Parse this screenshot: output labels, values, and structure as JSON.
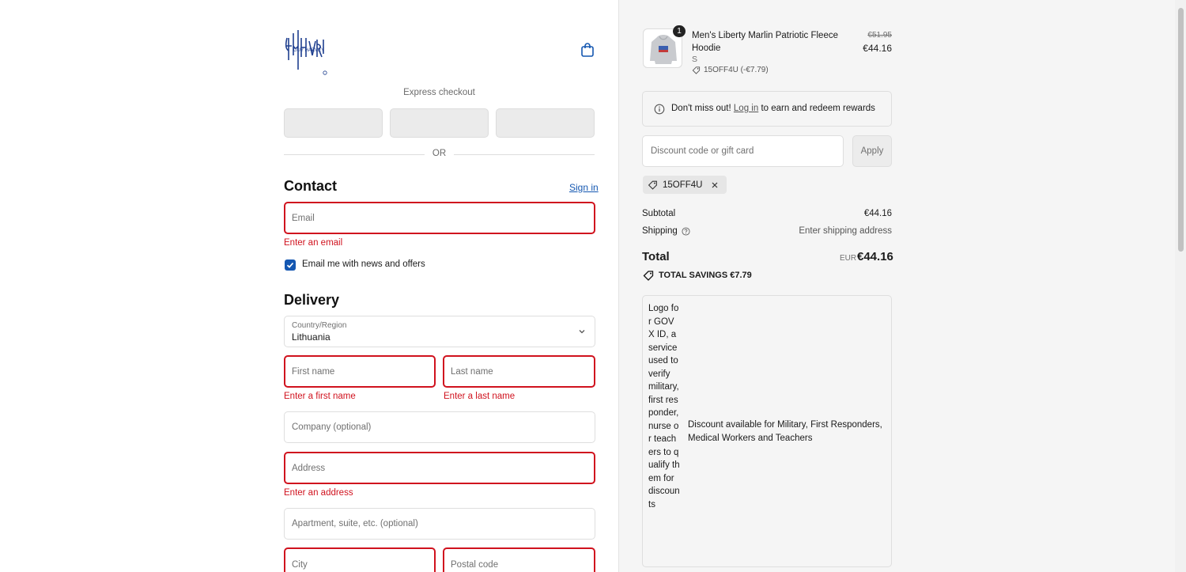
{
  "brand": {
    "logo_text": "GUY HARVEY"
  },
  "express": {
    "label": "Express checkout",
    "or_label": "OR"
  },
  "contact": {
    "heading": "Contact",
    "sign_in": "Sign in",
    "email_placeholder": "Email",
    "email_error": "Enter an email",
    "newsletter_label": "Email me with news and offers",
    "newsletter_checked": true
  },
  "delivery": {
    "heading": "Delivery",
    "country_label": "Country/Region",
    "country_value": "Lithuania",
    "first_name_placeholder": "First name",
    "first_name_error": "Enter a first name",
    "last_name_placeholder": "Last name",
    "last_name_error": "Enter a last name",
    "company_placeholder": "Company (optional)",
    "address_placeholder": "Address",
    "address_error": "Enter an address",
    "apartment_placeholder": "Apartment, suite, etc. (optional)",
    "city_placeholder": "City",
    "postal_placeholder": "Postal code"
  },
  "cart": {
    "item": {
      "quantity": "1",
      "name": "Men's Liberty Marlin Patriotic Fleece Hoodie",
      "size": "S",
      "discount": "15OFF4U (-€7.79)",
      "original_price": "€51.95",
      "price": "€44.16"
    },
    "rewards": {
      "prefix": "Don't miss out!",
      "link": "Log in",
      "suffix": "to earn and redeem rewards"
    },
    "discount_placeholder": "Discount code or gift card",
    "apply_label": "Apply",
    "applied_code": "15OFF4U",
    "subtotal_label": "Subtotal",
    "subtotal_value": "€44.16",
    "shipping_label": "Shipping",
    "shipping_value": "Enter shipping address",
    "total_label": "Total",
    "currency": "EUR",
    "total_value": "€44.16",
    "savings_label": "TOTAL SAVINGS €7.79",
    "govx_alt": "Logo for GOVX ID, a service used to verify military, first responder, nurse or teachers to qualify them for discounts",
    "govx_message": "Discount available for Military, First Responders, Medical Workers and Teachers"
  },
  "colors": {
    "accent": "#1457b1",
    "error": "#d0121e",
    "panel_bg": "#f5f5f5"
  }
}
